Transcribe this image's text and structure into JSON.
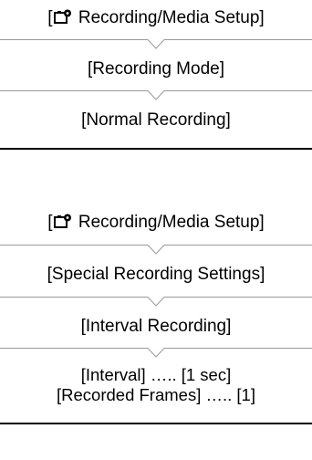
{
  "panel1": {
    "steps": [
      {
        "pre": "[",
        "icon": "camera-settings-icon",
        "text": " Recording/Media Setup]"
      },
      {
        "text": "[Recording Mode]"
      },
      {
        "text": "[Normal Recording]"
      }
    ]
  },
  "panel2": {
    "steps": [
      {
        "pre": "[",
        "icon": "camera-settings-icon",
        "text": " Recording/Media Setup]"
      },
      {
        "text": "[Special Recording Settings]"
      },
      {
        "text": "[Interval Recording]"
      },
      {
        "lines": [
          "[Interval] ….. [1 sec]",
          "[Recorded Frames] ….. [1]"
        ]
      }
    ]
  },
  "colors": {
    "text": "#000000",
    "divider": "#999999",
    "rule": "#000000"
  }
}
